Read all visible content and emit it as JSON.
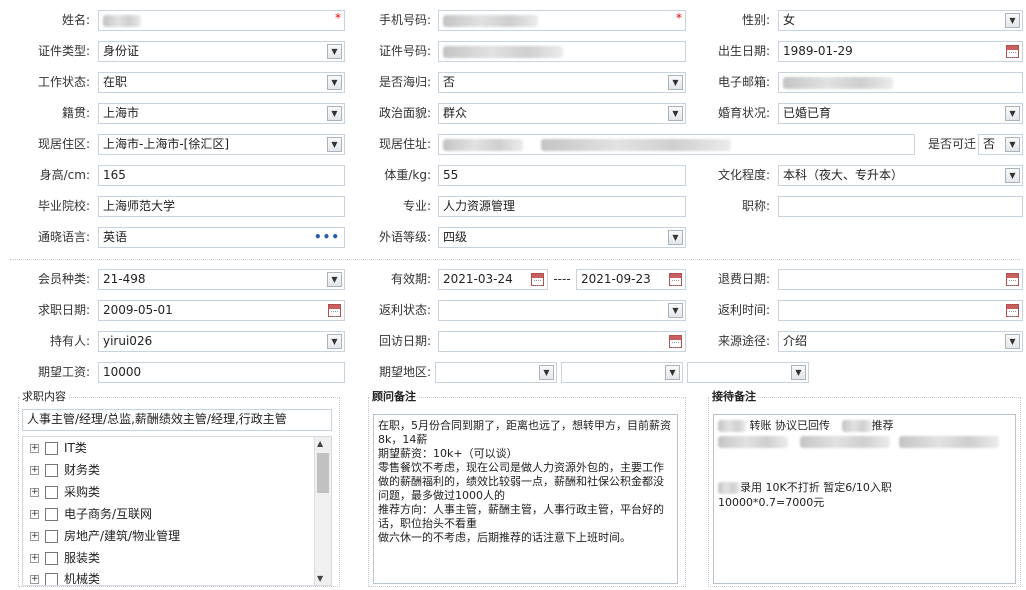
{
  "form": {
    "name": {
      "label": "姓名:",
      "value": ""
    },
    "phone": {
      "label": "手机号码:",
      "value": ""
    },
    "gender": {
      "label": "性别:",
      "value": "女"
    },
    "id_type": {
      "label": "证件类型:",
      "value": "身份证"
    },
    "id_number": {
      "label": "证件号码:",
      "value": ""
    },
    "birthdate": {
      "label": "出生日期:",
      "value": "1989-01-29"
    },
    "work_status": {
      "label": "工作状态:",
      "value": "在职"
    },
    "returnee": {
      "label": "是否海归:",
      "value": "否"
    },
    "email": {
      "label": "电子邮箱:",
      "value": ""
    },
    "native_place": {
      "label": "籍贯:",
      "value": "上海市"
    },
    "political": {
      "label": "政治面貌:",
      "value": "群众"
    },
    "marital": {
      "label": "婚育状况:",
      "value": "已婚已育"
    },
    "residence_area": {
      "label": "现居住区:",
      "value": "上海市-上海市-[徐汇区]"
    },
    "address": {
      "label": "现居住址:",
      "value": ""
    },
    "relocate": {
      "label": "是否可迁",
      "value": "否"
    },
    "height": {
      "label": "身高/cm:",
      "value": "165"
    },
    "weight": {
      "label": "体重/kg:",
      "value": "55"
    },
    "education": {
      "label": "文化程度:",
      "value": "本科（夜大、专升本）"
    },
    "school": {
      "label": "毕业院校:",
      "value": "上海师范大学"
    },
    "major": {
      "label": "专业:",
      "value": "人力资源管理"
    },
    "title": {
      "label": "职称:",
      "value": ""
    },
    "language": {
      "label": "通晓语言:",
      "value": "英语"
    },
    "lang_level": {
      "label": "外语等级:",
      "value": "四级"
    }
  },
  "member": {
    "type": {
      "label": "会员种类:",
      "value": "21-498"
    },
    "validity": {
      "label": "有效期:",
      "from": "2021-03-24",
      "sep": "----",
      "to": "2021-09-23"
    },
    "refund_date": {
      "label": "退费日期:",
      "value": ""
    },
    "job_date": {
      "label": "求职日期:",
      "value": "2009-05-01"
    },
    "rebate_status": {
      "label": "返利状态:",
      "value": ""
    },
    "rebate_time": {
      "label": "返利时间:",
      "value": ""
    },
    "holder": {
      "label": "持有人:",
      "value": "yirui026"
    },
    "visit_date": {
      "label": "回访日期:",
      "value": ""
    },
    "source": {
      "label": "来源途径:",
      "value": "介绍"
    },
    "salary": {
      "label": "期望工资:",
      "value": "10000"
    },
    "region": {
      "label": "期望地区:",
      "v1": "",
      "v2": "",
      "v3": ""
    }
  },
  "job_content": {
    "title": "求职内容",
    "summary": "人事主管/经理/总监,薪酬绩效主管/经理,行政主管",
    "tree": [
      "IT类",
      "财务类",
      "采购类",
      "电子商务/互联网",
      "房地产/建筑/物业管理",
      "服装类",
      "机械类"
    ]
  },
  "advisor_note": {
    "title": "顾问备注",
    "text": "在职，5月份合同到期了，距离也远了，想转甲方，目前薪资8k，14薪\n期望薪资：10k+（可以谈）\n零售餐饮不考虑，现在公司是做人力资源外包的，主要工作做的薪酬福利的，绩效比较弱一点，薪酬和社保公积金都没问题，最多做过1000人的\n推荐方向：人事主管，薪酬主管，人事行政主管，平台好的话，职位抬头不看重\n做六休一的不考虑，后期推荐的话注意下上班时间。"
  },
  "reception_note": {
    "title": "接待备注",
    "line1a": "转账 协议已回传",
    "line1b": "推荐",
    "line3": "录用 10K不打折  暂定6/10入职",
    "line4": "10000*0.7=7000元"
  }
}
